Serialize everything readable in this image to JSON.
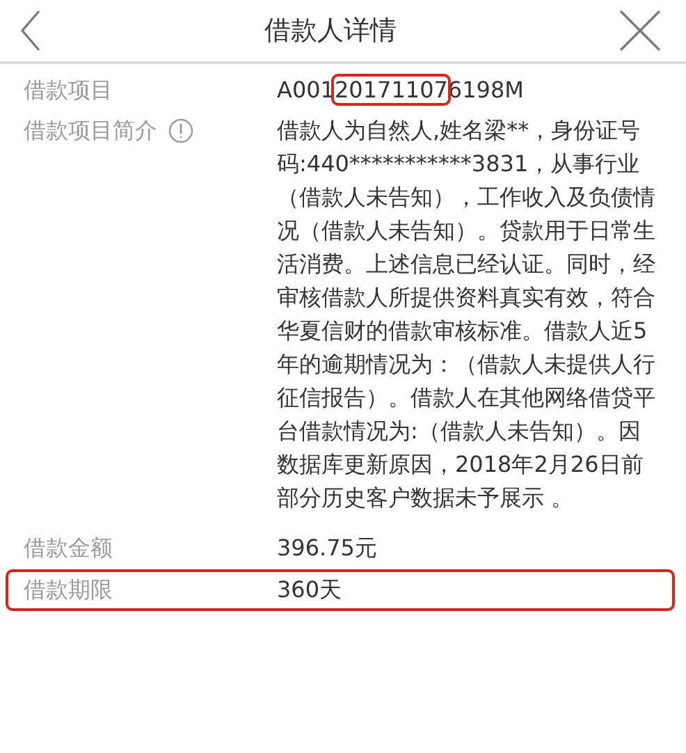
{
  "header": {
    "title": "借款人详情"
  },
  "rows": [
    {
      "label": "借款项目",
      "highlighted": false,
      "value_parts": [
        {
          "text": "A001",
          "highlighted": false
        },
        {
          "text": "20171107",
          "highlighted": true
        },
        {
          "text": "6198M",
          "highlighted": false
        }
      ]
    },
    {
      "label": "借款项目简介",
      "info_icon": true,
      "highlighted": false,
      "value_parts": [
        {
          "text": "借款人为自然人,姓名梁**，身份证号码:440***********3831，从事行业（借款人未告知），工作收入及负债情况（借款人未告知）。贷款用于日常生活消费。上述信息已经认证。同时，经审核借款人所提供资料真实有效，符合华夏信财的借款审核标准。借款人近5年的逾期情况为：（借款人未提供人行征信报告）。借款人在其他网络借贷平台借款情况为:（借款人未告知）。因数据库更新原因，2018年2月26日前部分历史客户数据未予展示 。",
          "highlighted": false
        }
      ]
    },
    {
      "label": "借款金额",
      "highlighted": false,
      "value_parts": [
        {
          "text": "396.75元",
          "highlighted": false
        }
      ]
    },
    {
      "label": "借款期限",
      "highlighted": true,
      "value_parts": [
        {
          "text": "360天",
          "highlighted": false
        }
      ]
    }
  ]
}
